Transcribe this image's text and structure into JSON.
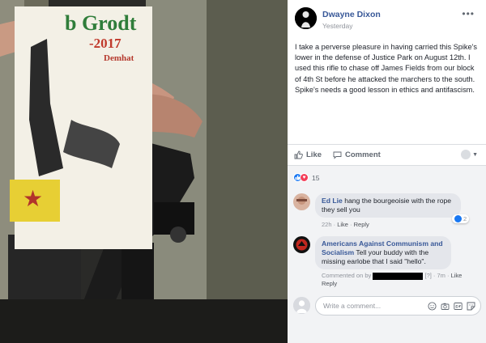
{
  "photo": {
    "poster_title": "b Grodt",
    "poster_years": "-2017",
    "poster_sub": "Demhat"
  },
  "post": {
    "author": "Dwayne Dixon",
    "time": "Yesterday",
    "options_glyph": "•••",
    "body": "I take a perverse pleasure in having carried this Spike's lower in the defense of Justice Park on August 12th. I used this rifle to chase off James Fields from our block of 4th St before he attacked the marchers to the south. Spike's needs a good lesson in ethics and antifascism."
  },
  "actions": {
    "like_label": "Like",
    "comment_label": "Comment",
    "like_icon": "thumbs-up-icon",
    "comment_icon": "speech-bubble-icon"
  },
  "reactions": {
    "count": "15",
    "types": [
      "like",
      "love"
    ]
  },
  "comments": [
    {
      "author": "Ed Lie",
      "text": "hang the bourgeoisie with the rope they sell you",
      "time": "22h",
      "like": "Like",
      "reply": "Reply",
      "reaction_count": "2"
    },
    {
      "author": "Americans Against Communism and Socialism",
      "text": "Tell your buddy with the missing earlobe that I said \"hello\".",
      "commented_on_by": "Commented on by",
      "marker": "[?]",
      "time": "7m",
      "like": "Like",
      "reply": "Reply"
    }
  ],
  "composer": {
    "placeholder": "Write a comment...",
    "icons": [
      "emoji-icon",
      "camera-icon",
      "gif-icon",
      "sticker-icon"
    ]
  },
  "colors": {
    "link": "#385898",
    "meta": "#90949c",
    "like_blue": "#1877f2",
    "love_red": "#f33e58",
    "comments_bg": "#f2f3f5"
  }
}
